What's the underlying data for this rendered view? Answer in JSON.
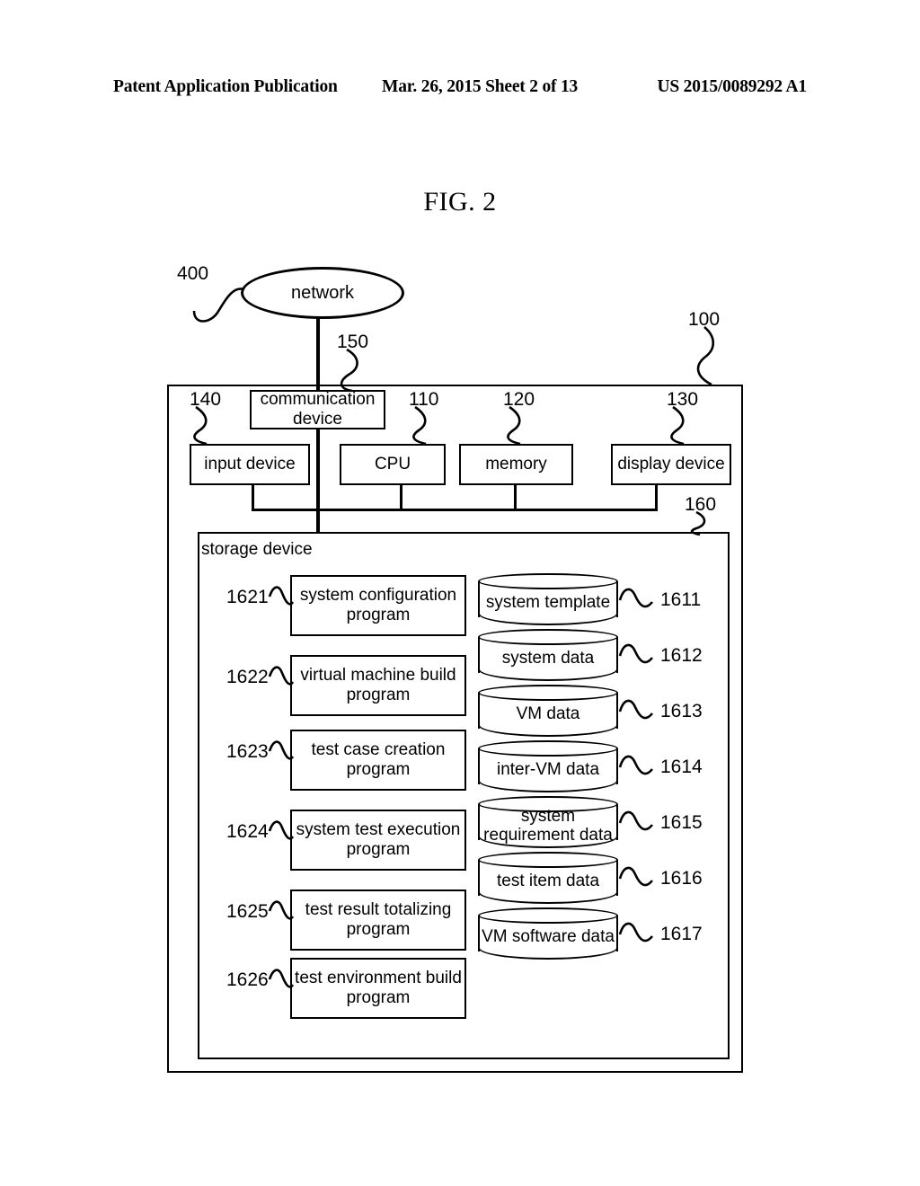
{
  "header": {
    "left": "Patent Application Publication",
    "middle": "Mar. 26, 2015  Sheet 2 of 13",
    "right": "US 2015/0089292 A1"
  },
  "figure": {
    "title": "FIG. 2"
  },
  "network": {
    "label": "network",
    "ref": "400"
  },
  "system": {
    "ref": "100"
  },
  "hardware": {
    "communication_device": {
      "label": "communication device",
      "line1": "communication",
      "line2": "device",
      "ref": "150"
    },
    "input_device": {
      "label": "input device",
      "ref": "140"
    },
    "cpu": {
      "label": "CPU",
      "ref": "110"
    },
    "memory": {
      "label": "memory",
      "ref": "120"
    },
    "display_device": {
      "label": "display device",
      "ref": "130"
    }
  },
  "storage": {
    "label": "storage device",
    "ref": "160",
    "programs": [
      {
        "ref": "1621",
        "line1": "system configuration",
        "line2": "program"
      },
      {
        "ref": "1622",
        "line1": "virtual machine build",
        "line2": "program"
      },
      {
        "ref": "1623",
        "line1": "test case creation",
        "line2": "program"
      },
      {
        "ref": "1624",
        "line1": "system test execution",
        "line2": "program"
      },
      {
        "ref": "1625",
        "line1": "test result totalizing",
        "line2": "program"
      },
      {
        "ref": "1626",
        "line1": "test environment build",
        "line2": "program"
      }
    ],
    "databases": [
      {
        "ref": "1611",
        "line1": "system template",
        "line2": ""
      },
      {
        "ref": "1612",
        "line1": "system data",
        "line2": ""
      },
      {
        "ref": "1613",
        "line1": "VM data",
        "line2": ""
      },
      {
        "ref": "1614",
        "line1": "inter-VM data",
        "line2": ""
      },
      {
        "ref": "1615",
        "line1": "system",
        "line2": "requirement data"
      },
      {
        "ref": "1616",
        "line1": "test item data",
        "line2": ""
      },
      {
        "ref": "1617",
        "line1": "VM software data",
        "line2": ""
      }
    ]
  }
}
